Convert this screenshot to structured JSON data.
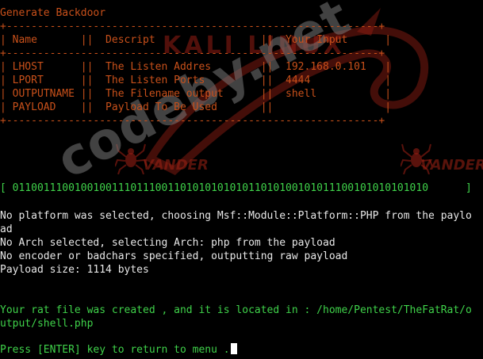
{
  "watermarks": {
    "site": "codeby.net",
    "distro": "KALI LINUX",
    "vander_left": "VANDER",
    "vander_right": "VANDER"
  },
  "menu": {
    "title": "Generate Backdoor",
    "border_top": "+------------------------------------------------------------+",
    "header_row": "| Name       ||  Descript                 ||  Your Input      |",
    "border_mid": "+------------------------------------------------------------+",
    "rows": [
      "| LHOST      ||  The Listen Addres        ||  192.168.0.101   |",
      "| LPORT      ||  The Listen Ports         ||  4444            |",
      "| OUTPUTNAME ||  The Filename output      ||  shell           |",
      "| PAYLOAD    ||  Payload To Be Used       ||                  |"
    ],
    "border_bottom": "+------------------------------------------------------------+"
  },
  "progress": {
    "text": "[ 0110011100100100111011100110101010101011010100101011100101010101010      ]"
  },
  "output": {
    "lines": [
      "No platform was selected, choosing Msf::Module::Platform::PHP from the paylo",
      "ad",
      "No Arch selected, selecting Arch: php from the payload",
      "No encoder or badchars specified, outputting raw payload",
      "Payload size: 1114 bytes"
    ]
  },
  "result": {
    "line1": "Your rat file was created , and it is located in : /home/Pentest/TheFatRat/o",
    "line2": "utput/shell.php"
  },
  "prompt": {
    "text": "Press [ENTER] key to return to menu ."
  },
  "colors": {
    "background": "#000000",
    "table": "#c8501a",
    "green": "#3fd24a",
    "text": "#e8e8e8"
  }
}
